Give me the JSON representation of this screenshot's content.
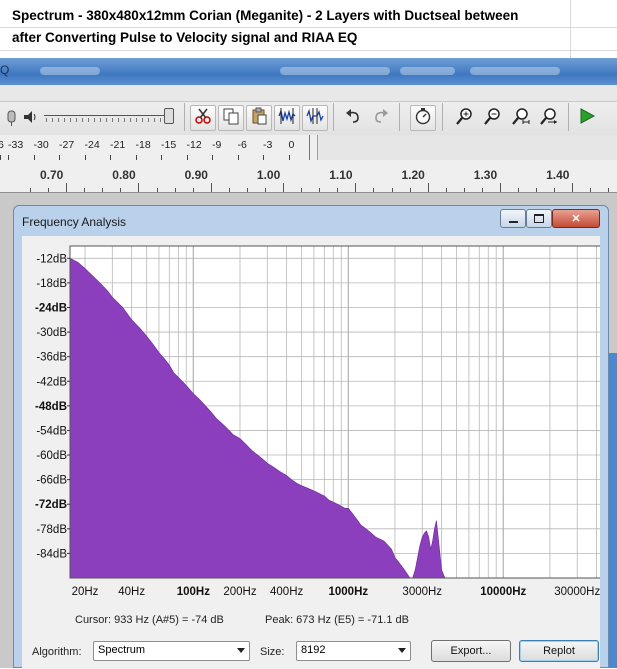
{
  "caption": {
    "line1": "Spectrum - 380x480x12mm Corian (Meganite) - 2 Layers with Ductseal between",
    "line2": "after Converting Pulse to Velocity signal and RIAA EQ"
  },
  "main_window": {
    "title_fragment": "Q"
  },
  "meter_ruler": {
    "labels": [
      "6",
      "-33",
      "-30",
      "-27",
      "-24",
      "-21",
      "-18",
      "-15",
      "-12",
      "-9",
      "-6",
      "-3",
      "0"
    ]
  },
  "timeline": {
    "labels": [
      "0.70",
      "0.80",
      "0.90",
      "1.00",
      "1.10",
      "1.20",
      "1.30",
      "1.40"
    ]
  },
  "dialog": {
    "title": "Frequency Analysis",
    "cursor_text": "Cursor: 933 Hz (A#5) = -74 dB",
    "peak_text": "Peak: 673 Hz (E5) = -71.1 dB",
    "algorithm_label": "Algorithm:",
    "algorithm_value": "Spectrum",
    "size_label": "Size:",
    "size_value": "8192",
    "export_label": "Export...",
    "replot_label": "Replot"
  },
  "colors": {
    "spectrum_fill": "#8b3fbd",
    "grid": "#b7b7b7"
  },
  "chart_data": {
    "type": "area",
    "title": "",
    "xlabel": "",
    "ylabel": "",
    "x_scale": "log",
    "xlim": [
      16,
      44000
    ],
    "ylim": [
      -90,
      -9
    ],
    "y_tick_labels": [
      "-12dB",
      "-18dB",
      "-24dB",
      "-30dB",
      "-36dB",
      "-42dB",
      "-48dB",
      "-54dB",
      "-60dB",
      "-66dB",
      "-72dB",
      "-78dB",
      "-84dB"
    ],
    "y_bold_labels": [
      "-24dB",
      "-48dB",
      "-72dB"
    ],
    "x_tick_labels": [
      {
        "label": "20Hz",
        "hz": 20,
        "bold": false
      },
      {
        "label": "40Hz",
        "hz": 40,
        "bold": false
      },
      {
        "label": "100Hz",
        "hz": 100,
        "bold": true
      },
      {
        "label": "200Hz",
        "hz": 200,
        "bold": false
      },
      {
        "label": "400Hz",
        "hz": 400,
        "bold": false
      },
      {
        "label": "1000Hz",
        "hz": 1000,
        "bold": true
      },
      {
        "label": "3000Hz",
        "hz": 3000,
        "bold": false
      },
      {
        "label": "10000Hz",
        "hz": 10000,
        "bold": true
      },
      {
        "label": "30000Hz",
        "hz": 30000,
        "bold": false
      }
    ],
    "grid": true,
    "series": [
      {
        "x": [
          16,
          18,
          20,
          22,
          25,
          28,
          30,
          35,
          40,
          45,
          50,
          55,
          60,
          65,
          70,
          75,
          80,
          90,
          100,
          110,
          120,
          130,
          140,
          150,
          160,
          170,
          180,
          200,
          220,
          240,
          260,
          280,
          300,
          330,
          360,
          400,
          430,
          470,
          500,
          540,
          580,
          620,
          660,
          700,
          750,
          800,
          850,
          900,
          950,
          1000,
          1050,
          1100,
          1150,
          1200,
          1300,
          1400,
          1500,
          1600,
          1700,
          1800,
          1900,
          2000,
          2100,
          2200,
          2300,
          2400,
          2500,
          2600,
          2700,
          2800,
          2900,
          3000,
          3100,
          3200,
          3300,
          3400,
          3500,
          3600,
          3700,
          3800,
          3900,
          4000,
          4200
        ],
        "y": [
          -12,
          -13,
          -14.5,
          -16,
          -18,
          -20,
          -21.5,
          -24,
          -27,
          -29,
          -31,
          -33,
          -35,
          -36.5,
          -38,
          -40,
          -41,
          -43,
          -45,
          -46.5,
          -48,
          -49.5,
          -51,
          -52,
          -53,
          -54,
          -55,
          -56,
          -57.5,
          -59,
          -60,
          -61,
          -62,
          -63,
          -64,
          -65,
          -66,
          -67,
          -67.5,
          -68,
          -68.5,
          -69,
          -69.5,
          -70,
          -71,
          -71.5,
          -72,
          -72.5,
          -73,
          -73,
          -74,
          -75,
          -76,
          -77,
          -78,
          -79,
          -80,
          -80.5,
          -81,
          -82,
          -83,
          -85,
          -86,
          -87,
          -88,
          -89,
          -90,
          -90,
          -88,
          -85,
          -82,
          -80,
          -79,
          -78.5,
          -80,
          -83,
          -81,
          -78,
          -76,
          -80,
          -84,
          -88,
          -90
        ]
      }
    ]
  }
}
